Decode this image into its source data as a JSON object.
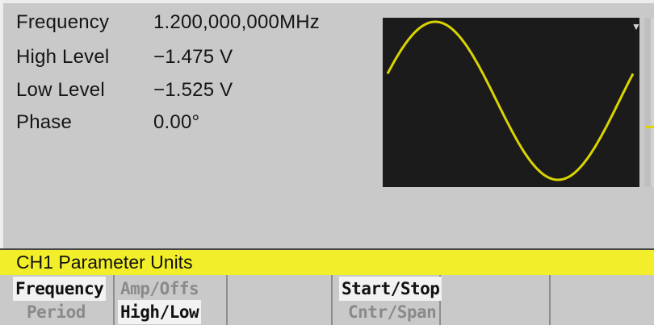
{
  "parameters": [
    {
      "label": "Frequency",
      "value": "1.200,000,000MHz"
    },
    {
      "label": "High Level",
      "value": "−1.475 V"
    },
    {
      "label": "Low Level",
      "value": "−1.525 V"
    },
    {
      "label": "Phase",
      "value": "0.00°"
    }
  ],
  "waveform": {
    "type": "sine",
    "trace_color": "#d9d400",
    "background": "#1b1b1b"
  },
  "menu_title": "CH1 Parameter Units",
  "softkeys": [
    {
      "top": "Frequency",
      "top_selected": true,
      "bottom": "Period",
      "bottom_selected": false
    },
    {
      "top": "Amp/Offs",
      "top_selected": false,
      "bottom": "High/Low",
      "bottom_selected": true
    },
    {
      "top": "",
      "bottom": ""
    },
    {
      "top": "Start/Stop",
      "top_selected": true,
      "bottom": "Cntr/Span",
      "bottom_selected": false
    },
    {
      "top": "",
      "bottom": ""
    },
    {
      "top": "",
      "bottom": ""
    }
  ],
  "colors": {
    "menu_bar": "#f2ef2a",
    "screen_background": "#c9c9c9",
    "selected_key": "#f2f2f2"
  }
}
